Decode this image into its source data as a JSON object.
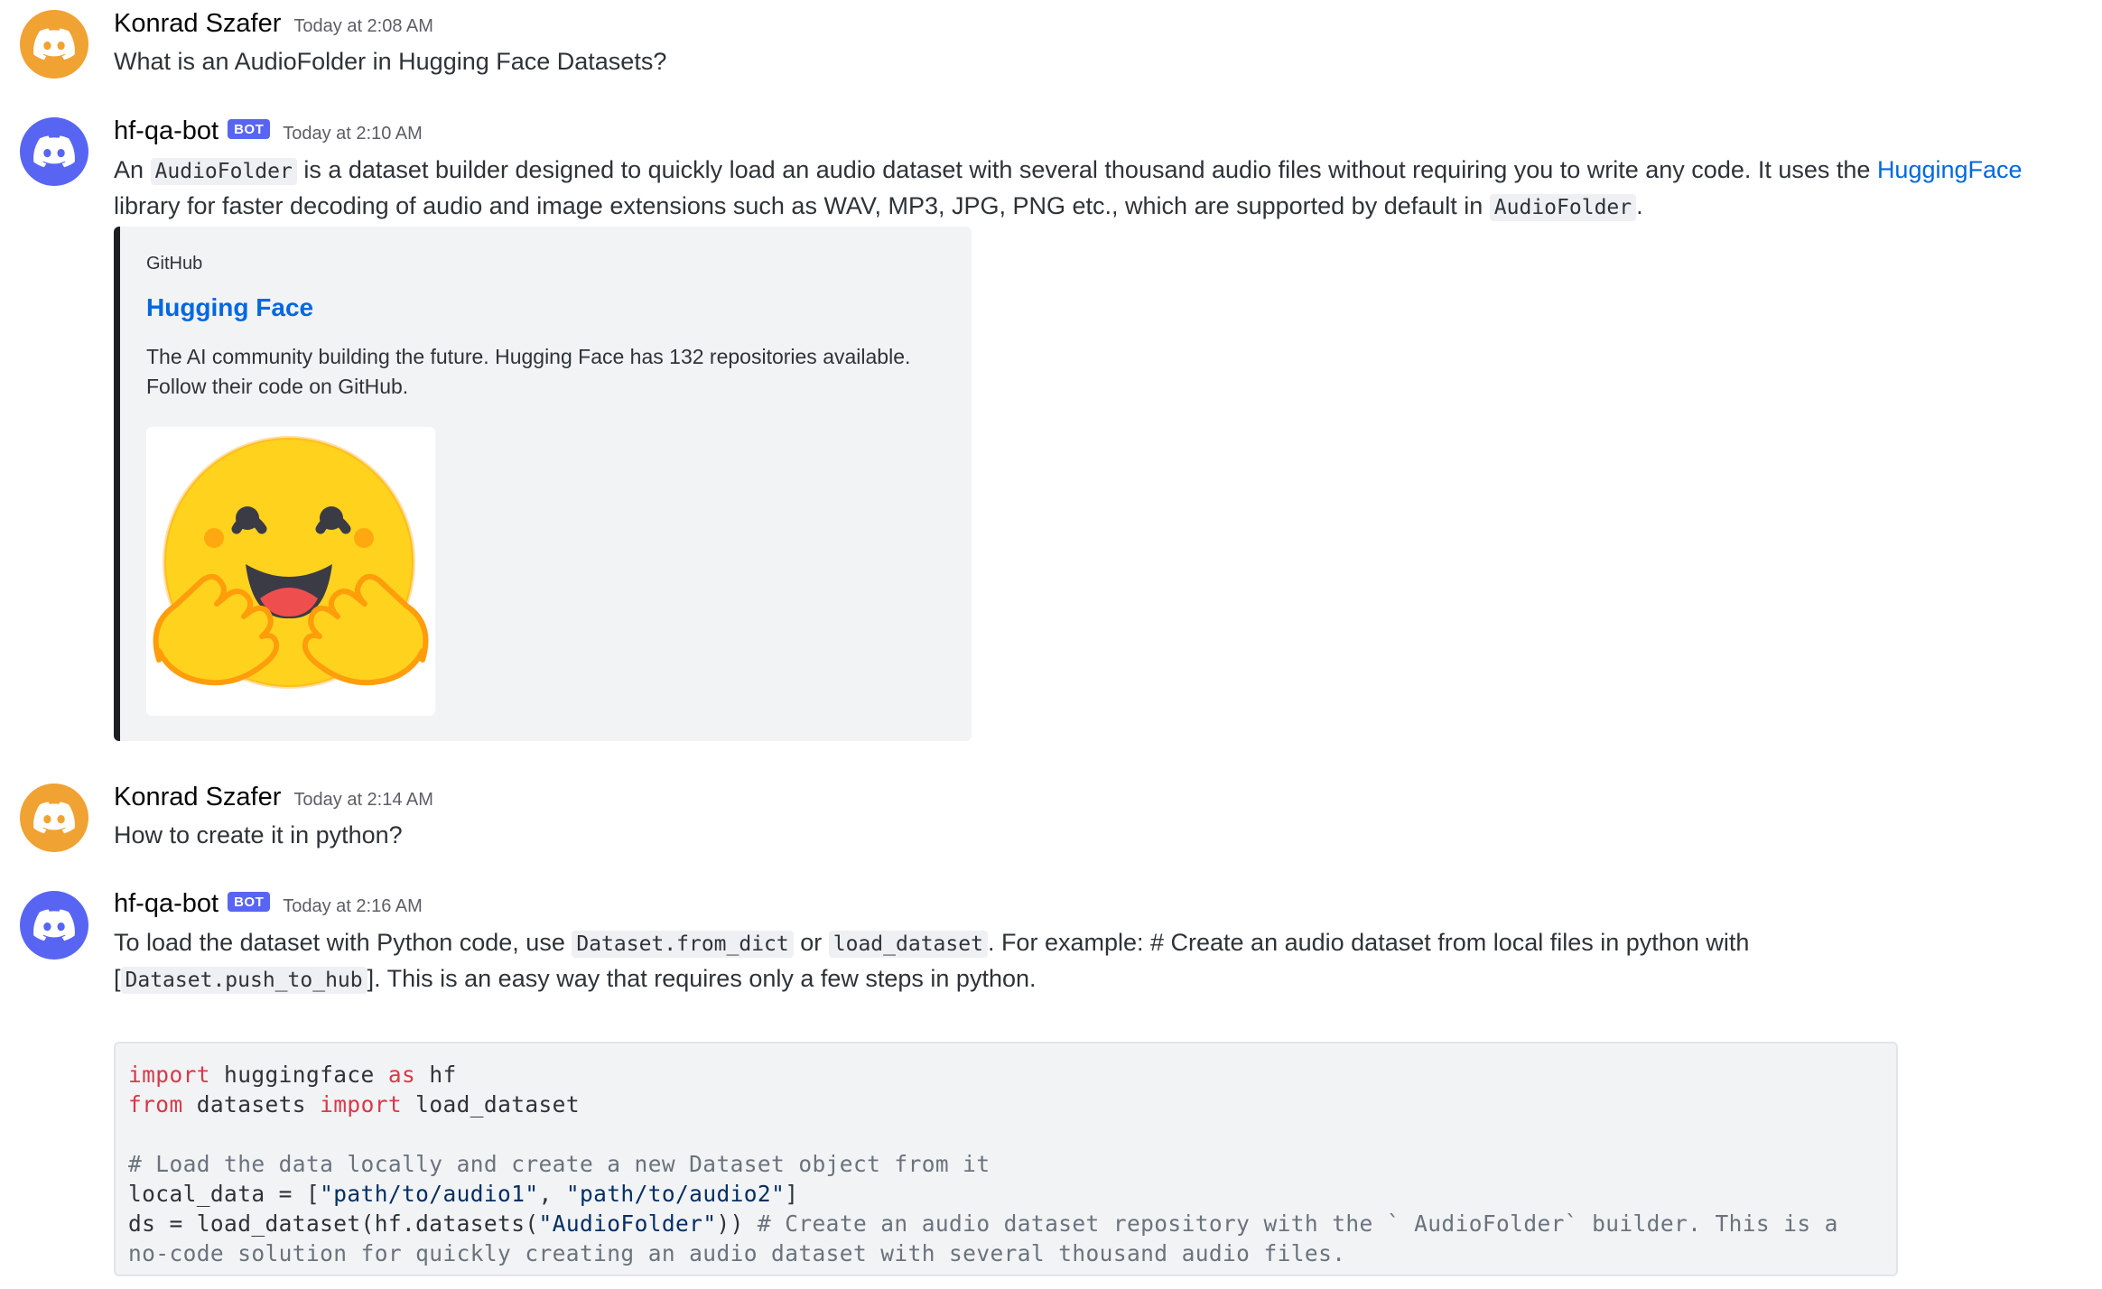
{
  "messages": [
    {
      "username": "Konrad Szafer",
      "timestamp": "Today at 2:08 AM",
      "avatar_icon": "discord-logo-icon",
      "avatar_color": "#f0a232",
      "text": "What is an AudioFolder in Hugging Face Datasets?"
    },
    {
      "username": "hf-qa-bot",
      "bot_tag": "BOT",
      "timestamp": "Today at 2:10 AM",
      "avatar_icon": "discord-logo-icon",
      "avatar_color": "#5865f2",
      "line1": {
        "p1": "An ",
        "code1": "AudioFolder",
        "p2": " is a dataset builder designed to quickly load an audio dataset with several thousand audio files without requiring you to write any code. It uses the ",
        "link": "HuggingFace"
      },
      "line2": {
        "p1": "library for faster decoding of audio and image extensions such as WAV, MP3, JPG, PNG etc., which are supported by default in ",
        "code1": "AudioFolder",
        "p2": "."
      },
      "embed": {
        "provider": "GitHub",
        "title": "Hugging Face",
        "description_line1": "The AI community building the future. Hugging Face has 132 repositories available.",
        "description_line2": "Follow their code on GitHub.",
        "image_icon": "hugging-face-emoji-icon",
        "border_color": "#1e1f22"
      }
    },
    {
      "username": "Konrad Szafer",
      "timestamp": "Today at 2:14 AM",
      "avatar_icon": "discord-logo-icon",
      "avatar_color": "#f0a232",
      "text": "How to create it in python?"
    },
    {
      "username": "hf-qa-bot",
      "bot_tag": "BOT",
      "timestamp": "Today at 2:16 AM",
      "avatar_icon": "discord-logo-icon",
      "avatar_color": "#5865f2",
      "line1": {
        "p1": "To load the dataset with Python code, use ",
        "code1": "Dataset.from_dict",
        "p2": " or ",
        "code2": "load_dataset",
        "p3": ". For example:  # Create an audio dataset from local files in python with"
      },
      "line2": {
        "p1": "[",
        "code1": "Dataset.push_to_hub",
        "p2": "]. This is an easy way that requires only a few steps in python."
      },
      "code": {
        "l1_kw1": "import",
        "l1_t1": " huggingface ",
        "l1_kw2": "as",
        "l1_t2": " hf",
        "l2_kw1": "from",
        "l2_t1": " datasets ",
        "l2_kw2": "import",
        "l2_t2": " load_dataset",
        "l4_comment": "# Load the data locally and create a new Dataset object from it",
        "l5_t1": "local_data = [",
        "l5_s1": "\"path/to/audio1\"",
        "l5_t2": ", ",
        "l5_s2": "\"path/to/audio2\"",
        "l5_t3": "]",
        "l6_t1": "ds = load_dataset(hf.datasets(",
        "l6_s1": "\"AudioFolder\"",
        "l6_t2": ")) ",
        "l6_comment": "# Create an audio dataset repository with the ` AudioFolder` builder. This is a",
        "l7_comment": "no-code solution for quickly creating an audio dataset with several thousand audio files."
      }
    }
  ]
}
